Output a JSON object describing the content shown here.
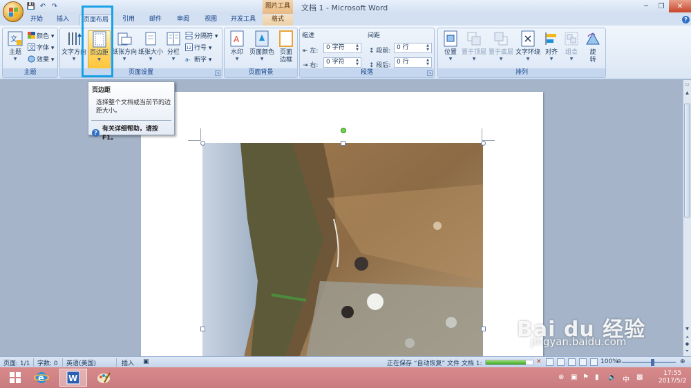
{
  "window": {
    "title": "文档 1 - Microsoft Word",
    "context_tab_title": "图片工具",
    "min": "─",
    "max": "❐",
    "close": "✕"
  },
  "quick_access": [
    "💾",
    "↶",
    "↷"
  ],
  "tabs": [
    {
      "label": "开始"
    },
    {
      "label": "插入"
    },
    {
      "label": "页面布局"
    },
    {
      "label": "引用"
    },
    {
      "label": "邮件"
    },
    {
      "label": "审阅"
    },
    {
      "label": "视图"
    },
    {
      "label": "开发工具"
    },
    {
      "label": "格式"
    }
  ],
  "ribbon": {
    "theme_group": {
      "label": "主题",
      "themes": "主题",
      "colors": "颜色 ▾",
      "fonts": "字体 ▾",
      "effects": "效果 ▾"
    },
    "page_setup_group": {
      "label": "页面设置",
      "text_direction": "文字方向",
      "margins": "页边距",
      "orientation": "纸张方向",
      "size": "纸张大小",
      "columns": "分栏",
      "breaks": "分隔符 ▾",
      "line_numbers": "行号 ▾",
      "hyphenation": "断字 ▾"
    },
    "page_background_group": {
      "label": "页面背景",
      "watermark": "水印",
      "page_color": "页面颜色",
      "page_borders_1": "页面",
      "page_borders_2": "边框"
    },
    "paragraph_group": {
      "label": "段落",
      "indent": "缩进",
      "spacing": "间距",
      "left_label": "左:",
      "left_value": "0 字符",
      "right_label": "右:",
      "right_value": "0 字符",
      "before_label": "段前:",
      "before_value": "0 行",
      "after_label": "段后:",
      "after_value": "0 行"
    },
    "arrange_group": {
      "label": "排列",
      "position": "位置",
      "bring_front": "置于顶层",
      "send_back": "置于底层",
      "wrap": "文字环绕",
      "align": "对齐",
      "group": "组合",
      "rotate_1": "旋",
      "rotate_2": "转"
    }
  },
  "tooltip": {
    "title": "页边距",
    "desc_1": "选择整个文档或当前节的边",
    "desc_2": "距大小。",
    "help": "有关详细帮助，请按 F1。"
  },
  "statusbar": {
    "page": "页面: 1/1",
    "words": "字数: 0",
    "language": "英语(美国)",
    "insert": "插入",
    "saving": "正在保存 “自动恢复” 文件 文档 1:",
    "zoom": "100%"
  },
  "watermark_text": {
    "main": "Bai du 经验",
    "sub": "jingyan.baidu.com"
  },
  "taskbar": {
    "time": "17:55",
    "date": "2017/5/2",
    "ime": "中"
  }
}
